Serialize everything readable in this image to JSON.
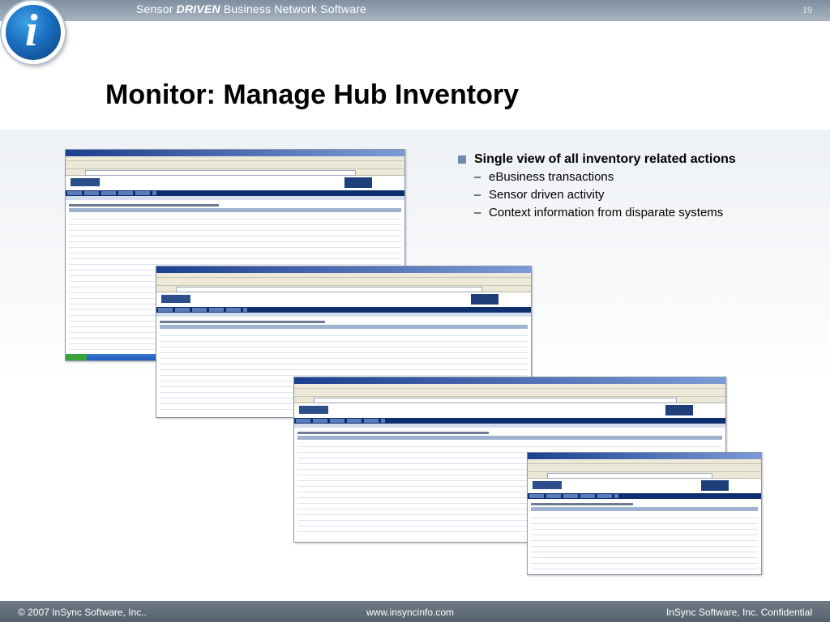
{
  "header": {
    "tagline_prefix": "Sensor ",
    "tagline_emph": "DRIVEN",
    "tagline_suffix": " Business Network Software",
    "slide_number": "19",
    "logo_letter": "i"
  },
  "slide": {
    "title": "Monitor: Manage Hub Inventory"
  },
  "bullets": {
    "main": "Single view of all inventory related actions",
    "subs": [
      "eBusiness transactions",
      "Sensor driven activity",
      "Context information from disparate systems"
    ]
  },
  "screenshots": [
    "inventory-status-screen",
    "inventory-movement-screen",
    "in-transit-shipment-screen",
    "purchase-order-screen"
  ],
  "footer": {
    "copyright": "© 2007 InSync Software, Inc..",
    "website": "www.insyncinfo.com",
    "confidential": "InSync Software, Inc. Confidential"
  },
  "colors": {
    "accent": "#6b8bb0",
    "nav_blue": "#0d2f6e",
    "footer_gray": "#6f7b88"
  }
}
